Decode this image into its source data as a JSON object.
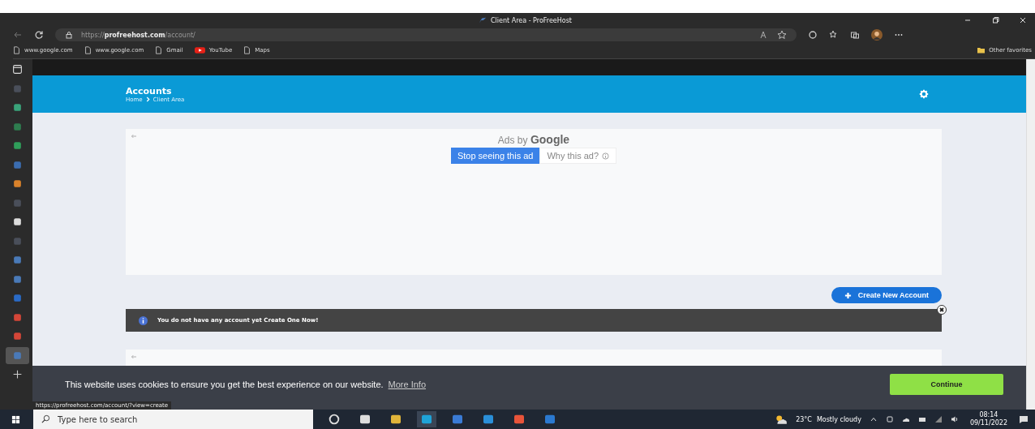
{
  "window": {
    "title": "Client Area - ProFreeHost"
  },
  "address_bar": {
    "scheme": "https://",
    "domain": "profreehost.com",
    "path": "/account/"
  },
  "bookmarks": [
    {
      "label": "www.google.com",
      "kind": "page"
    },
    {
      "label": "www.google.com",
      "kind": "page"
    },
    {
      "label": "Gmail",
      "kind": "page"
    },
    {
      "label": "YouTube",
      "kind": "youtube"
    },
    {
      "label": "Maps",
      "kind": "page"
    }
  ],
  "other_favorites": "Other favorites",
  "page": {
    "title": "Accounts",
    "breadcrumb": [
      "Home",
      "Client Area"
    ]
  },
  "ad": {
    "label": "Ads by",
    "brand": "Google",
    "stop_button": "Stop seeing this ad",
    "why_button": "Why this ad?"
  },
  "create_button": "Create New Account",
  "alert": "You do not have any account yet Create One Now!",
  "cookie": {
    "text": "This website uses cookies to ensure you get the best experience on our website.",
    "link": "More Info",
    "button": "Continue"
  },
  "status_url": "https://profreehost.com/account/?view=create",
  "taskbar": {
    "search_placeholder": "Type here to search",
    "temperature": "23°C",
    "weather": "Mostly cloudy",
    "time": "08:14",
    "date": "09/11/2022"
  }
}
